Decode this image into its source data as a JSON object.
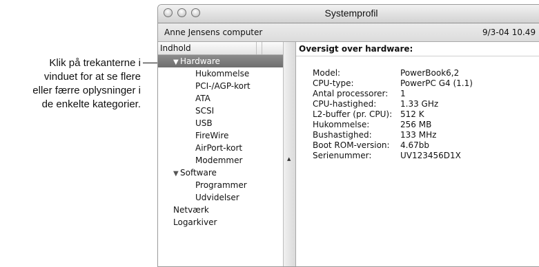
{
  "callout": {
    "lines": [
      "Klik på trekanterne i",
      "vinduet for at se flere",
      "eller færre oplysninger i",
      "de enkelte kategorier."
    ]
  },
  "window": {
    "title": "Systemprofil",
    "computer_name": "Anne Jensens computer",
    "date": "9/3-04 10.49"
  },
  "sidebar": {
    "header": "Indhold",
    "items": [
      {
        "label": "Hardware",
        "level": 0,
        "expanded": true,
        "selected": true
      },
      {
        "label": "Hukommelse",
        "level": 1
      },
      {
        "label": "PCI-/AGP-kort",
        "level": 1
      },
      {
        "label": "ATA",
        "level": 1
      },
      {
        "label": "SCSI",
        "level": 1
      },
      {
        "label": "USB",
        "level": 1
      },
      {
        "label": "FireWire",
        "level": 1
      },
      {
        "label": "AirPort-kort",
        "level": 1
      },
      {
        "label": "Modemmer",
        "level": 1
      },
      {
        "label": "Software",
        "level": 0,
        "expanded": true
      },
      {
        "label": "Programmer",
        "level": 1
      },
      {
        "label": "Udvidelser",
        "level": 1
      },
      {
        "label": "Netværk",
        "level": 0
      },
      {
        "label": "Logarkiver",
        "level": 0
      }
    ]
  },
  "main": {
    "header": "Oversigt over hardware:",
    "specs": [
      {
        "key": "Model:",
        "value": "PowerBook6,2"
      },
      {
        "key": "CPU-type:",
        "value": "PowerPC G4  (1.1)"
      },
      {
        "key": "Antal processorer:",
        "value": "1"
      },
      {
        "key": "CPU-hastighed:",
        "value": "1.33 GHz"
      },
      {
        "key": "L2-buffer (pr. CPU):",
        "value": "512 K"
      },
      {
        "key": "Hukommelse:",
        "value": "256 MB"
      },
      {
        "key": "Bushastighed:",
        "value": "133 MHz"
      },
      {
        "key": "Boot ROM-version:",
        "value": "4.67bb"
      },
      {
        "key": "Serienummer:",
        "value": "UV123456D1X"
      }
    ]
  }
}
